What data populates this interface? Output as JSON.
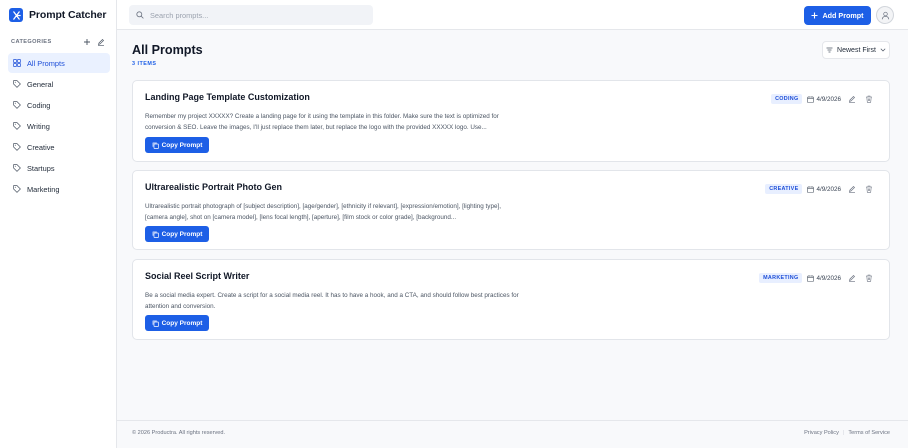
{
  "app": {
    "name": "Prompt Catcher"
  },
  "sidebar": {
    "categories_title": "CATEGORIES",
    "items": [
      {
        "label": "All Prompts",
        "icon": "grid-icon",
        "active": true
      },
      {
        "label": "General",
        "icon": "tag-icon"
      },
      {
        "label": "Coding",
        "icon": "tag-icon"
      },
      {
        "label": "Writing",
        "icon": "tag-icon"
      },
      {
        "label": "Creative",
        "icon": "tag-icon"
      },
      {
        "label": "Startups",
        "icon": "tag-icon"
      },
      {
        "label": "Marketing",
        "icon": "tag-icon"
      }
    ]
  },
  "topbar": {
    "search_placeholder": "Search prompts...",
    "add_label": "Add Prompt"
  },
  "main": {
    "title": "All Prompts",
    "count": "3 ITEMS",
    "sort_label": "Newest First"
  },
  "prompts": [
    {
      "title": "Landing Page Template Customization",
      "text": "Remember my project XXXXX? Create a landing page for it using the template in this folder. Make sure the text is optimized for conversion & SEO. Leave the images, I'll just replace them later, but replace the logo with the provided XXXXX logo. Use...",
      "tag": "CODING",
      "date": "4/9/2026",
      "copy_label": "Copy Prompt"
    },
    {
      "title": "Ultrarealistic Portrait Photo Gen",
      "text": "Ultrarealistic portrait photograph of [subject description], [age/gender], [ethnicity if relevant], [expression/emotion], [lighting type], [camera angle], shot on [camera model], [lens focal length], [aperture], [film stock or color grade], [background...",
      "tag": "CREATIVE",
      "date": "4/9/2026",
      "copy_label": "Copy Prompt"
    },
    {
      "title": "Social Reel Script Writer",
      "text": "Be a social media expert. Create a script for a social media reel. It has to have a hook, and a CTA, and should follow best practices for attention and conversion.",
      "tag": "MARKETING",
      "date": "4/9/2026",
      "copy_label": "Copy Prompt"
    }
  ],
  "footer": {
    "copyright": "© 2026 Productra. All rights reserved.",
    "privacy": "Privacy Policy",
    "separator": "|",
    "terms": "Terms of Service"
  },
  "colors": {
    "accent": "#1d5fe6",
    "tag_bg": "#e8efff"
  }
}
